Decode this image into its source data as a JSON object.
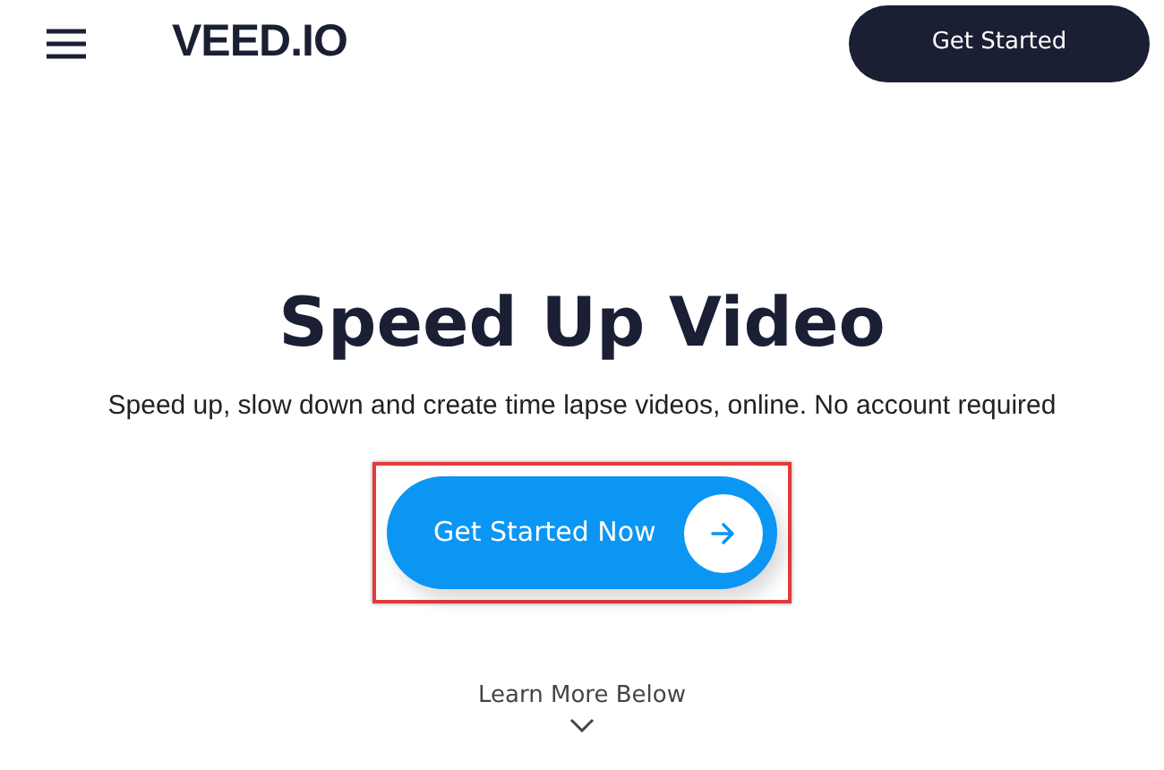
{
  "header": {
    "logo": "VEED.IO",
    "button": "Get Started"
  },
  "hero": {
    "title": "Speed Up Video",
    "subtitle": "Speed up, slow down and create time lapse videos, online. No account required",
    "cta": {
      "label": "Get Started Now",
      "highlighted": true
    },
    "learn_more": "Learn More Below"
  }
}
